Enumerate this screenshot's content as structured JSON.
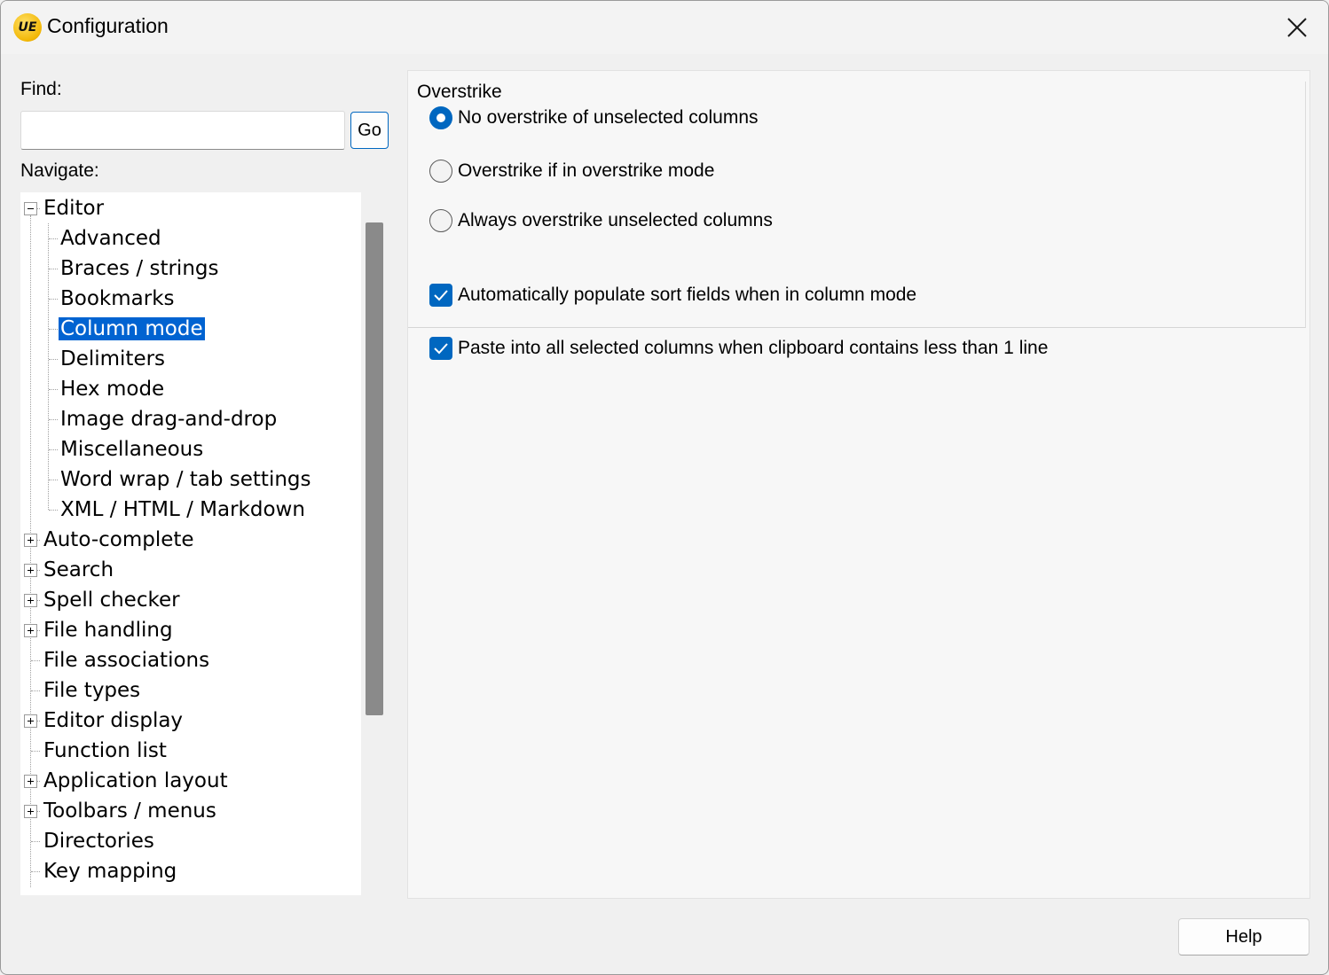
{
  "window": {
    "title": "Configuration",
    "logo_text": "UE",
    "close_icon": "close-icon"
  },
  "find": {
    "label": "Find:",
    "value": "",
    "placeholder": "",
    "go_label": "Go"
  },
  "navigate": {
    "label": "Navigate:",
    "items": [
      {
        "label": "Editor",
        "level": 0,
        "expander": "minus"
      },
      {
        "label": "Advanced",
        "level": 1
      },
      {
        "label": "Braces / strings",
        "level": 1
      },
      {
        "label": "Bookmarks",
        "level": 1
      },
      {
        "label": "Column mode",
        "level": 1,
        "selected": true
      },
      {
        "label": "Delimiters",
        "level": 1
      },
      {
        "label": "Hex mode",
        "level": 1
      },
      {
        "label": "Image drag-and-drop",
        "level": 1
      },
      {
        "label": "Miscellaneous",
        "level": 1
      },
      {
        "label": "Word wrap / tab settings",
        "level": 1
      },
      {
        "label": "XML / HTML / Markdown",
        "level": 1
      },
      {
        "label": "Auto-complete",
        "level": 0,
        "expander": "plus"
      },
      {
        "label": "Search",
        "level": 0,
        "expander": "plus"
      },
      {
        "label": "Spell checker",
        "level": 0,
        "expander": "plus"
      },
      {
        "label": "File handling",
        "level": 0,
        "expander": "plus"
      },
      {
        "label": "File associations",
        "level": 0
      },
      {
        "label": "File types",
        "level": 0
      },
      {
        "label": "Editor display",
        "level": 0,
        "expander": "plus"
      },
      {
        "label": "Function list",
        "level": 0
      },
      {
        "label": "Application layout",
        "level": 0,
        "expander": "plus"
      },
      {
        "label": "Toolbars / menus",
        "level": 0,
        "expander": "plus"
      },
      {
        "label": "Directories",
        "level": 0
      },
      {
        "label": "Key mapping",
        "level": 0
      }
    ]
  },
  "overstrike": {
    "title": "Overstrike",
    "options": [
      {
        "label": "No overstrike of unselected columns",
        "checked": true
      },
      {
        "label": "Overstrike if in overstrike mode",
        "checked": false
      },
      {
        "label": "Always overstrike unselected columns",
        "checked": false
      }
    ]
  },
  "checkboxes": [
    {
      "label": "Automatically populate sort fields when in column mode",
      "checked": true
    },
    {
      "label": "Paste into all selected columns when clipboard contains less than 1 line",
      "checked": true
    }
  ],
  "footer": {
    "help_label": "Help"
  },
  "colors": {
    "accent": "#0067c0",
    "selection": "#0063d1"
  }
}
